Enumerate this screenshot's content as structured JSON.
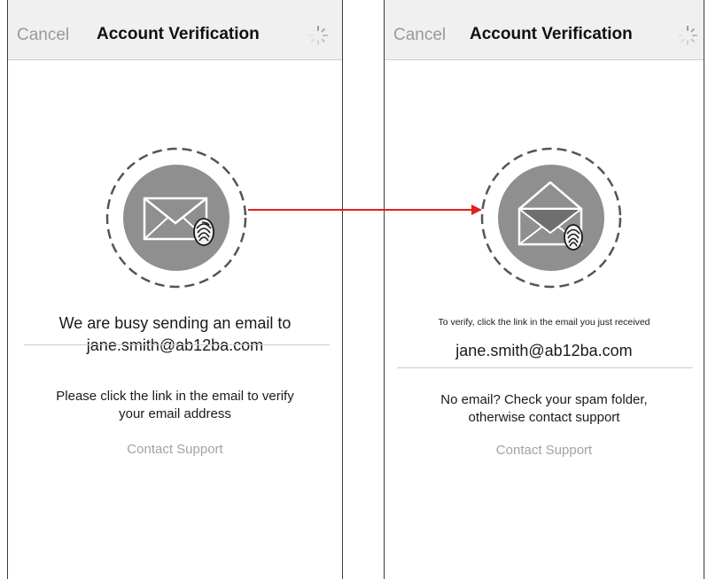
{
  "left_screen": {
    "cancel_label": "Cancel",
    "title": "Account Verification",
    "message_line1": "We are busy sending an email to",
    "email": "jane.smith@ab12ba.com",
    "note_line1": "Please click the link in the email to verify",
    "note_line2": "your email address",
    "support_label": "Contact Support",
    "icon": "closed-envelope-fingerprint-icon"
  },
  "right_screen": {
    "cancel_label": "Cancel",
    "title": "Account Verification",
    "message_line1": "To verify, click the link in the email you just received",
    "email": "jane.smith@ab12ba.com",
    "note_line1": "No email? Check your spam folder,",
    "note_line2": "otherwise contact support",
    "support_label": "Contact Support",
    "icon": "open-envelope-fingerprint-icon"
  },
  "colors": {
    "nav_background": "#f0f0f0",
    "cancel_text": "#9a9a9a",
    "support_text": "#a3a3a3",
    "icon_circle": "#8f8f8f",
    "arrow": "#e02020"
  }
}
